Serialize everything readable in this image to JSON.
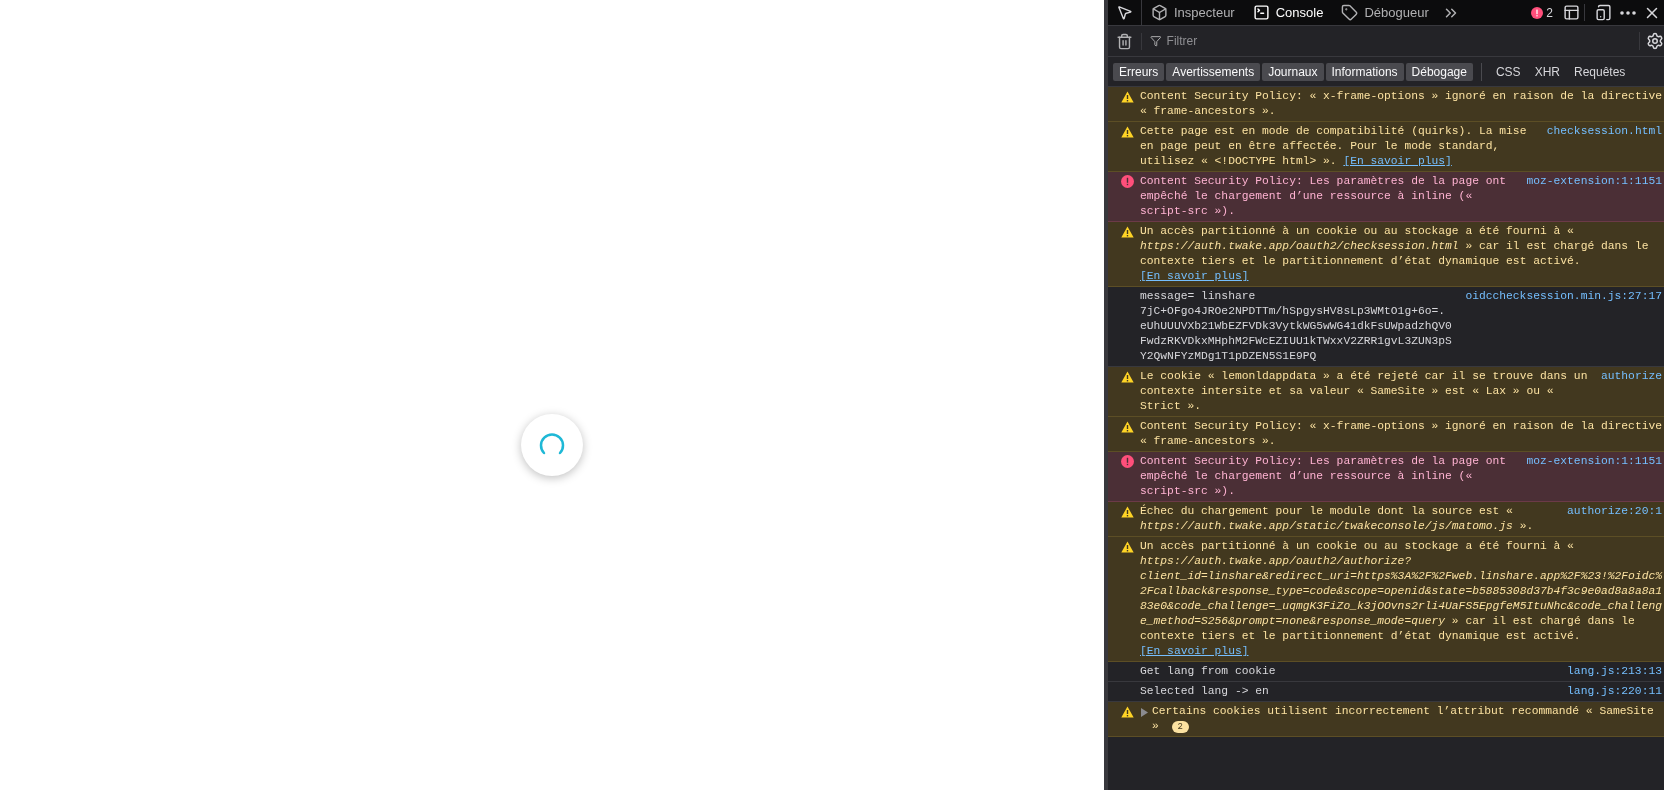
{
  "toolbar": {
    "tabs": [
      {
        "label": "Inspecteur",
        "selected": false
      },
      {
        "label": "Console",
        "selected": true
      },
      {
        "label": "Débogueur",
        "selected": false
      }
    ],
    "error_count": "2"
  },
  "filter": {
    "placeholder": "Filtrer"
  },
  "levels": [
    {
      "label": "Erreurs",
      "selected": true
    },
    {
      "label": "Avertissements",
      "selected": true
    },
    {
      "label": "Journaux",
      "selected": true
    },
    {
      "label": "Informations",
      "selected": true
    },
    {
      "label": "Débogage",
      "selected": true
    }
  ],
  "categories": [
    {
      "label": "CSS",
      "selected": false
    },
    {
      "label": "XHR",
      "selected": false
    },
    {
      "label": "Requêtes",
      "selected": false
    }
  ],
  "messages": [
    {
      "kind": "warning",
      "text": "Content Security Policy: « x-frame-options » ignoré en raison de la directive « frame-ancestors »."
    },
    {
      "kind": "warning",
      "text": "Cette page est en mode de compatibilité (quirks). La mise en page peut en être affectée. Pour le mode standard, utilisez « <!DOCTYPE html> ».",
      "link": "[En savoir plus]",
      "location": "checksession.html"
    },
    {
      "kind": "error",
      "text": "Content Security Policy: Les paramètres de la page ont empêché le chargement d’une ressource à inline (« script-src »).",
      "location": "moz-extension:1:1151"
    },
    {
      "kind": "warning",
      "text": "Un accès partitionné à un cookie ou au stockage a été fourni à « *https://auth.twake.app/oauth2/checksession.html* » car il est chargé dans le contexte tiers et le partitionnement d’état dynamique est activé.",
      "link": "[En savoir plus]"
    },
    {
      "kind": "log",
      "text": "message= linshare 7jC+OFgo4JROe2NPDTTm/hSpgysHV8sLp3WMtO1g+6o=. eUhUUUVXb21WbEZFVDk3VytkWG5wWG41dkFsUWpadzhQV0FwdzRKVDkxMHphM2FWcEZIUU1kTWxxV2ZRR1gvL3ZUN3pSY2QwNFYzMDg1T1pDZEN5S1E9PQ",
      "location": "oidcchecksession.min.js:27:17"
    },
    {
      "kind": "warning",
      "text": "Le cookie « lemonldappdata » a été rejeté car il se trouve dans un contexte intersite et sa valeur « SameSite » est « Lax » ou « Strict ».",
      "location": "authorize"
    },
    {
      "kind": "warning",
      "text": "Content Security Policy: « x-frame-options » ignoré en raison de la directive « frame-ancestors »."
    },
    {
      "kind": "error",
      "text": "Content Security Policy: Les paramètres de la page ont empêché le chargement d’une ressource à inline (« script-src »).",
      "location": "moz-extension:1:1151"
    },
    {
      "kind": "warning",
      "text": "Échec du chargement pour le module dont la source est « *https://auth.twake.app/static/twakeconsole/js/matomo.js* ».",
      "location": "authorize:20:1"
    },
    {
      "kind": "warning",
      "text": "Un accès partitionné à un cookie ou au stockage a été fourni à « *https://auth.twake.app/oauth2/authorize?client_id=linshare&redirect_uri=https%3A%2F%2Fweb.linshare.app%2F%23!%2Foidc%2Fcallback&response_type=code&scope=openid&state=b5885308d37b4f3c9e0ad8a8a8a183e0&code_challenge=_uqmgK3FiZo_k3jOOvns2rli4UaFS5EpgfeM5ItuNhc&code_challenge_method=S256&prompt=none&response_mode=query* » car il est chargé dans le contexte tiers et le partitionnement d’état dynamique est activé.",
      "link": "[En savoir plus]"
    },
    {
      "kind": "log",
      "text": "Get lang from cookie",
      "location": "lang.js:213:13"
    },
    {
      "kind": "log",
      "text": "Selected lang -> en",
      "location": "lang.js:220:11"
    },
    {
      "kind": "warning",
      "text": "Certains cookies utilisent incorrectement l’attribut recommandé « SameSite »",
      "expanded": false,
      "count": "2"
    }
  ]
}
